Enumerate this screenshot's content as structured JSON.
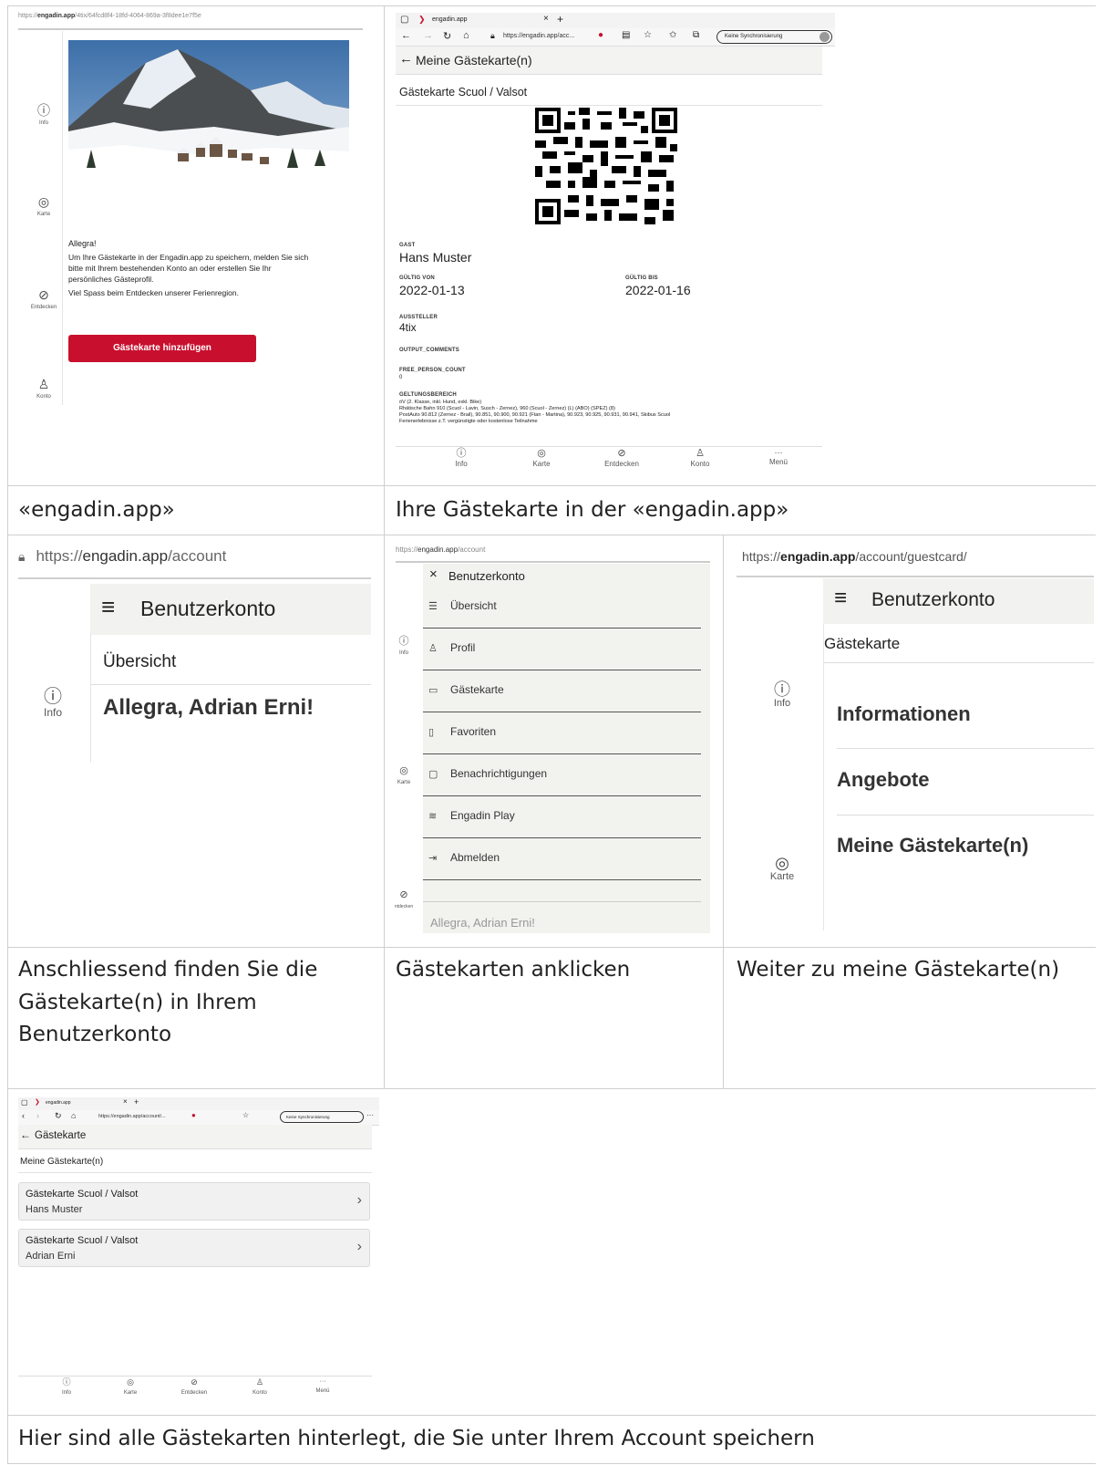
{
  "cell1": {
    "url_prefix": "https://",
    "url_host": "engadin.app",
    "url_path": "/4tix/64fcd8f4-18fd-4064-869a-3f8dee1e7f5e",
    "rail": [
      {
        "icon": "ⓘ",
        "label": "Info"
      },
      {
        "icon": "◎",
        "label": "Karte"
      },
      {
        "icon": "⊘",
        "label": "Entdecken"
      },
      {
        "icon": "♙",
        "label": "Konto"
      }
    ],
    "greeting": "Allegra!",
    "intro_line1": "Um Ihre Gästekarte in der Engadin.app zu speichern, melden Sie sich",
    "intro_line2": "bitte mit Ihrem bestehenden Konto an oder erstellen Sie Ihr",
    "intro_line3": "persönliches Gästeprofil.",
    "intro_line4": "Viel Spass beim Entdecken unserer Ferienregion.",
    "button_label": "Gästekarte hinzufügen"
  },
  "cell2": {
    "tab_title": "engadin.app",
    "tab_close": "×",
    "tab_new": "+",
    "address": "https://engadin.app/acc...",
    "sync_label": "Keine Synchronisierung",
    "header_back": "←",
    "header_title": "Meine Gästekarte(n)",
    "card_title": "Gästekarte Scuol / Valsot",
    "gast_label": "GAST",
    "gast_value": "Hans Muster",
    "von_label": "GÜLTIG VON",
    "von_value": "2022-01-13",
    "bis_label": "GÜLTIG BIS",
    "bis_value": "2022-01-16",
    "aussteller_label": "AUSSTELLER",
    "aussteller_value": "4tix",
    "comments_label": "OUTPUT_COMMENTS",
    "free_label": "FREE_PERSON_COUNT",
    "free_value": "0",
    "geltung_label": "GELTUNGSBEREICH",
    "geltung_line1": "öV (2. Klasse, inkl. Hund, exkl. Bike)",
    "geltung_line2": "Rhätische Bahn 910 (Scuol - Lavin, Susch - Zernez), 960 (Scuol - Zernez) (L) (ABO) (SPEZ) (8)",
    "geltung_line3": "PostAuto 90.812 (Zernez - Brail), 90.851, 90.900, 90.921 (Ftan - Martina), 90.923, 90.925, 90.931, 90.941, Skibus Scuol",
    "geltung_line4": "Ferienerlebnisse z.T. vergünstigte oder kostenlose Teilnahme",
    "bottom_nav": [
      {
        "icon": "ⓘ",
        "label": "Info"
      },
      {
        "icon": "◎",
        "label": "Karte"
      },
      {
        "icon": "⊘",
        "label": "Entdecken"
      },
      {
        "icon": "♙",
        "label": "Konto"
      },
      {
        "icon": "···",
        "label": "Menü"
      }
    ]
  },
  "captions": {
    "c1": "«engadin.app»",
    "c2": "Ihre Gästekarte in der «engadin.app»",
    "c3_l1": "Anschliessend finden Sie die",
    "c3_l2": "Gästekarte(n) in Ihrem",
    "c3_l3": "Benutzerkonto",
    "c4": "Gästekarten anklicken",
    "c5": "Weiter zu meine Gästekarte(n)",
    "c6": "Hier sind alle Gästekarten hinterlegt, die Sie unter Ihrem Account speichern"
  },
  "cell3": {
    "url_prefix": "https://",
    "url_host": "engadin.app",
    "url_path": "/account",
    "menu_icon": "≡",
    "header_title": "Benutzerkonto",
    "subtitle": "Übersicht",
    "greeting": "Allegra, Adrian Erni!",
    "rail_icon": "ⓘ",
    "rail_label": "Info"
  },
  "cell4": {
    "url_prefix": "https://",
    "url_host": "engadin.app",
    "url_path": "/account",
    "close_icon": "×",
    "menu_title": "Benutzerkonto",
    "items": [
      {
        "icon": "☰",
        "label": "Übersicht"
      },
      {
        "icon": "♙",
        "label": "Profil"
      },
      {
        "icon": "▭",
        "label": "Gästekarte"
      },
      {
        "icon": "▯",
        "label": "Favoriten"
      },
      {
        "icon": "▢",
        "label": "Benachrichtigungen"
      },
      {
        "icon": "≋",
        "label": "Engadin Play"
      },
      {
        "icon": "⇥",
        "label": "Abmelden"
      }
    ],
    "rail": [
      {
        "icon": "ⓘ",
        "label": "Info"
      },
      {
        "icon": "◎",
        "label": "Karte"
      },
      {
        "icon": "⊘",
        "label": "ntdecken"
      }
    ],
    "footer_greeting": "Allegra, Adrian Erni!"
  },
  "cell5": {
    "url_prefix": "https://",
    "url_host": "engadin.app",
    "url_path": "/account/guestcard/",
    "menu_icon": "≡",
    "header_title": "Benutzerkonto",
    "subtitle": "Gästekarte",
    "sections": [
      "Informationen",
      "Angebote",
      "Meine Gästekarte(n)"
    ],
    "rail": [
      {
        "icon": "ⓘ",
        "label": "Info"
      },
      {
        "icon": "◎",
        "label": "Karte"
      }
    ]
  },
  "cell6": {
    "tab_title": "engadin.app",
    "tab_close": "×",
    "tab_new": "+",
    "address": "https://engadin.app/account/...",
    "sync_label": "Keine Synchronisierung",
    "header_back": "←",
    "header_title": "Gästekarte",
    "subtitle": "Meine Gästekarte(n)",
    "cards": [
      {
        "title": "Gästekarte Scuol / Valsot",
        "name": "Hans Muster"
      },
      {
        "title": "Gästekarte Scuol / Valsot",
        "name": "Adrian Erni"
      }
    ],
    "bottom_nav": [
      {
        "icon": "ⓘ",
        "label": "Info"
      },
      {
        "icon": "◎",
        "label": "Karte"
      },
      {
        "icon": "⊘",
        "label": "Entdecken"
      },
      {
        "icon": "♙",
        "label": "Konto"
      },
      {
        "icon": "···",
        "label": "Menü"
      }
    ]
  }
}
